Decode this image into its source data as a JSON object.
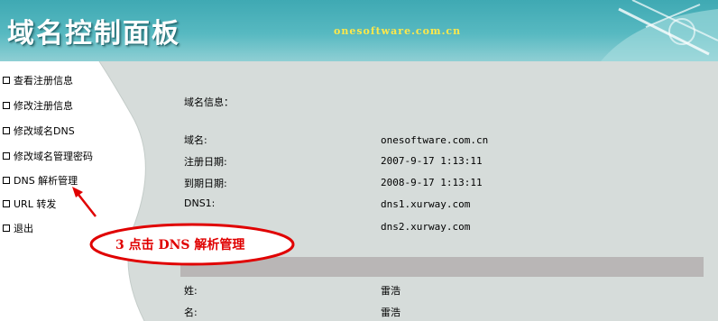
{
  "header": {
    "title": "域名控制面板",
    "domain": "onesoftware.com.cn"
  },
  "sidebar": {
    "items": [
      {
        "label": "查看注册信息"
      },
      {
        "label": "修改注册信息"
      },
      {
        "label": "修改域名DNS"
      },
      {
        "label": "修改域名管理密码"
      },
      {
        "label": "DNS 解析管理"
      },
      {
        "label": "URL 转发"
      },
      {
        "label": "退出"
      }
    ]
  },
  "info": {
    "section_title": "域名信息：",
    "domain_label": "域名:",
    "domain_value": "onesoftware.com.cn",
    "reg_date_label": "注册日期:",
    "reg_date_value": "2007-9-17 1:13:11",
    "exp_date_label": "到期日期:",
    "exp_date_value": "2008-9-17 1:13:11",
    "dns1_label": "DNS1:",
    "dns1_value": "dns1.xurway.com",
    "dns2_value": "dns2.xurway.com",
    "surname_label": "姓:",
    "surname_value": "雷浩",
    "name_label": "名:",
    "name_value": "雷浩"
  },
  "annotation": {
    "text": "3  点击 DNS 解析管理",
    "color": "#e00000"
  },
  "colors": {
    "header_teal": "#4fb3bb",
    "content_gray": "#d6dcda",
    "bar_gray": "#b9b6b6",
    "domain_yellow": "#ffe84a"
  }
}
